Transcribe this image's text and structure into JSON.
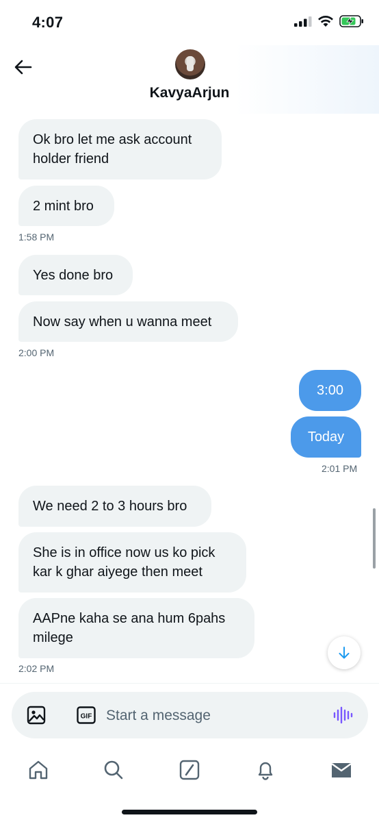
{
  "status_bar": {
    "time": "4:07"
  },
  "header": {
    "contact_name": "KavyaArjun"
  },
  "messages": [
    {
      "text_lines": [
        "Ok bro let me ask account",
        "holder friend"
      ]
    },
    {
      "text": "2 mint bro"
    },
    {
      "stamp": "1:58 PM"
    },
    {
      "text": "Yes done bro"
    },
    {
      "text": "Now say when u wanna meet"
    },
    {
      "stamp": "2:00 PM"
    },
    {
      "text": "3:00"
    },
    {
      "text": "Today"
    },
    {
      "stamp": "2:01 PM"
    },
    {
      "text": "We need 2 to 3 hours bro"
    },
    {
      "text_lines": [
        "She is in office now us ko pick",
        "kar k ghar aiyege then meet"
      ]
    },
    {
      "text_lines": [
        "AAPne kaha se ana hum 6pahs",
        "milege"
      ]
    },
    {
      "stamp": "2:02 PM"
    }
  ],
  "composer": {
    "placeholder": "Start a message",
    "gif_label": "GIF"
  },
  "icons": {
    "back": "arrow-left-icon",
    "media": "image-icon",
    "gif": "gif-icon",
    "voice": "voice-wave-icon",
    "scroll_down": "arrow-down-icon",
    "tabs": [
      "home-icon",
      "search-icon",
      "grok-icon",
      "bell-icon",
      "mail-icon"
    ]
  },
  "colors": {
    "sent_bubble": "#4c9aea",
    "received_bubble": "#eff3f4",
    "accent": "#1d9bf0",
    "voice_accent": "#7856ff",
    "battery": "#34c759"
  }
}
